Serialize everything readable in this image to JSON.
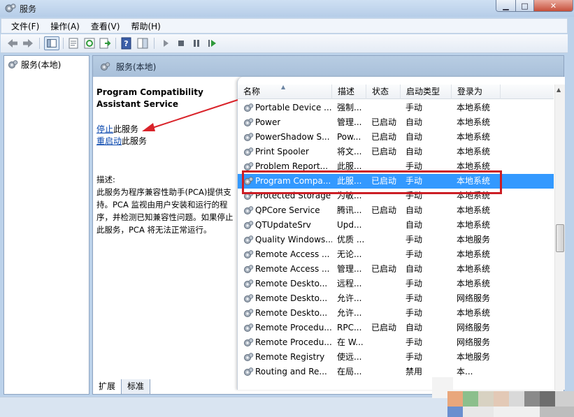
{
  "window": {
    "title": "服务",
    "buttons": {
      "minimize": "▁",
      "maximize": "□",
      "close": "✕"
    }
  },
  "menu": [
    "文件(F)",
    "操作(A)",
    "查看(V)",
    "帮助(H)"
  ],
  "toolbar_icons": [
    "back-arrow-icon",
    "forward-arrow-icon",
    "console-tree-icon",
    "properties-icon",
    "refresh-icon",
    "export-list-icon",
    "help-icon",
    "show-hide-pane-icon",
    "start-service-icon",
    "stop-service-icon",
    "pause-service-icon",
    "restart-service-icon"
  ],
  "tree": {
    "root_label": "服务(本地)"
  },
  "panel": {
    "header": "服务(本地)",
    "service_title": "Program Compatibility Assistant Service",
    "stop_link": "停止",
    "stop_suffix": "此服务",
    "restart_link": "重启动",
    "restart_suffix": "此服务",
    "desc_label": "描述:",
    "description": "此服务为程序兼容性助手(PCA)提供支持。PCA 监视由用户安装和运行的程序，并检测已知兼容性问题。如果停止此服务，PCA 将无法正常运行。"
  },
  "columns": [
    "名称",
    "描述",
    "状态",
    "启动类型",
    "登录为"
  ],
  "services": [
    {
      "name": "Portable Device ...",
      "desc": "强制...",
      "status": "",
      "startup": "手动",
      "logon": "本地系统"
    },
    {
      "name": "Power",
      "desc": "管理...",
      "status": "已启动",
      "startup": "自动",
      "logon": "本地系统"
    },
    {
      "name": "PowerShadow S...",
      "desc": "Pow...",
      "status": "已启动",
      "startup": "自动",
      "logon": "本地系统"
    },
    {
      "name": "Print Spooler",
      "desc": "将文...",
      "status": "已启动",
      "startup": "自动",
      "logon": "本地系统"
    },
    {
      "name": "Problem Report...",
      "desc": "此服...",
      "status": "",
      "startup": "手动",
      "logon": "本地系统"
    },
    {
      "name": "Program Compa...",
      "desc": "此服...",
      "status": "已启动",
      "startup": "手动",
      "logon": "本地系统"
    },
    {
      "name": "Protected Storage",
      "desc": "为敏...",
      "status": "",
      "startup": "手动",
      "logon": "本地系统"
    },
    {
      "name": "QPCore Service",
      "desc": "腾讯...",
      "status": "已启动",
      "startup": "自动",
      "logon": "本地系统"
    },
    {
      "name": "QTUpdateSrv",
      "desc": "Upd...",
      "status": "",
      "startup": "自动",
      "logon": "本地系统"
    },
    {
      "name": "Quality Windows...",
      "desc": "优质 ...",
      "status": "",
      "startup": "手动",
      "logon": "本地服务"
    },
    {
      "name": "Remote Access ...",
      "desc": "无论...",
      "status": "",
      "startup": "手动",
      "logon": "本地系统"
    },
    {
      "name": "Remote Access ...",
      "desc": "管理...",
      "status": "已启动",
      "startup": "自动",
      "logon": "本地系统"
    },
    {
      "name": "Remote Deskto...",
      "desc": "远程...",
      "status": "",
      "startup": "手动",
      "logon": "本地系统"
    },
    {
      "name": "Remote Deskto...",
      "desc": "允许...",
      "status": "",
      "startup": "手动",
      "logon": "网络服务"
    },
    {
      "name": "Remote Deskto...",
      "desc": "允许...",
      "status": "",
      "startup": "手动",
      "logon": "本地系统"
    },
    {
      "name": "Remote Procedu...",
      "desc": "RPC...",
      "status": "已启动",
      "startup": "自动",
      "logon": "网络服务"
    },
    {
      "name": "Remote Procedu...",
      "desc": "在 W...",
      "status": "",
      "startup": "手动",
      "logon": "网络服务"
    },
    {
      "name": "Remote Registry",
      "desc": "使远...",
      "status": "",
      "startup": "手动",
      "logon": "本地服务"
    },
    {
      "name": "Routing and Re...",
      "desc": "在局...",
      "status": "",
      "startup": "禁用",
      "logon": "本..."
    }
  ],
  "selected_index": 5,
  "tabs": [
    "扩展",
    "标准"
  ],
  "colors": {
    "selection": "#3399ff",
    "highlight_box": "#cc1e25",
    "annotation_arrow": "#d9232a"
  }
}
